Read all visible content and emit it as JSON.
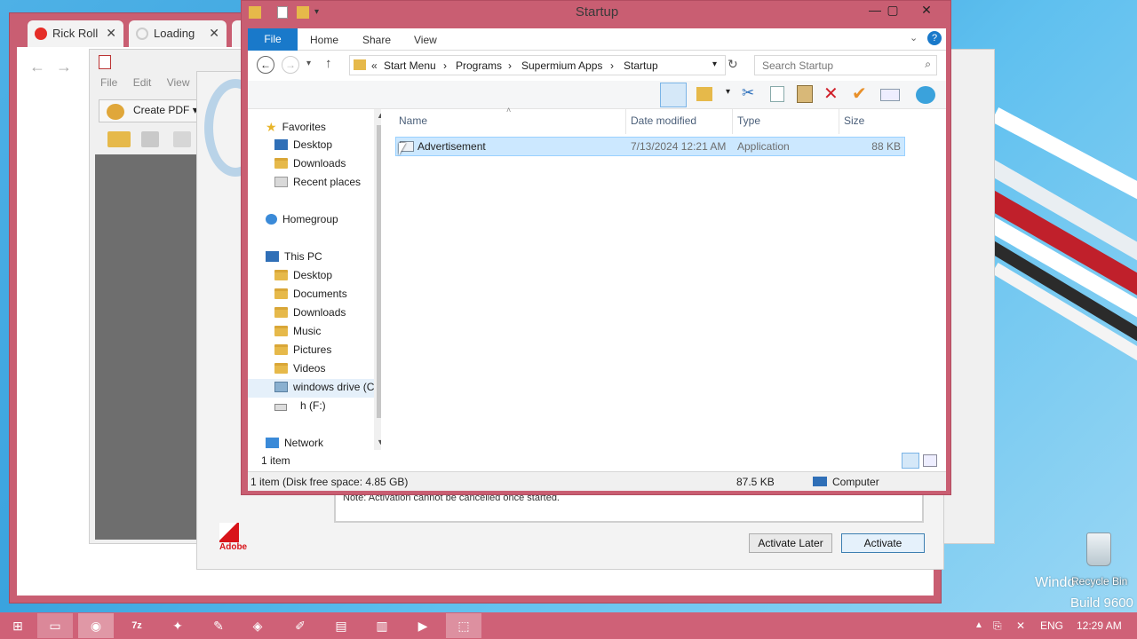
{
  "browser": {
    "tabs": [
      {
        "label": "Rick Roll",
        "icon": "youtube-icon"
      },
      {
        "label": "Loading",
        "icon": "loading-icon"
      }
    ]
  },
  "pdf_app": {
    "menu": [
      "File",
      "Edit",
      "View"
    ],
    "create_pdf_label": "Create PDF",
    "brand_label": "Adobe"
  },
  "dialog": {
    "note": "Note: Activation cannot be cancelled once started.",
    "activate_later_label": "Activate Later",
    "activate_label": "Activate"
  },
  "explorer": {
    "title": "Startup",
    "ribbon_tabs": [
      "File",
      "Home",
      "Share",
      "View"
    ],
    "breadcrumb": {
      "prefix": "«",
      "items": [
        "Start Menu",
        "Programs",
        "Supermium Apps",
        "Startup"
      ]
    },
    "search_placeholder": "Search Startup",
    "nav": {
      "favorites": {
        "label": "Favorites",
        "items": [
          "Desktop",
          "Downloads",
          "Recent places"
        ]
      },
      "homegroup": "Homegroup",
      "this_pc": {
        "label": "This PC",
        "items": [
          "Desktop",
          "Documents",
          "Downloads",
          "Music",
          "Pictures",
          "Videos",
          "windows drive (C",
          "h (F:)"
        ]
      },
      "network": "Network"
    },
    "columns": [
      "Name",
      "Date modified",
      "Type",
      "Size"
    ],
    "files": [
      {
        "name": "Advertisement",
        "date": "7/13/2024 12:21 AM",
        "type": "Application",
        "size": "88 KB"
      }
    ],
    "item_count": "1 item",
    "status": {
      "summary": "1 item (Disk free space: 4.85 GB)",
      "size": "87.5 KB",
      "location": "Computer"
    }
  },
  "desktop": {
    "recycle_bin_label": "Recycle Bin",
    "watermark_line1": "Windo",
    "watermark_line2": "Build 9600"
  },
  "taskbar": {
    "language": "ENG",
    "time": "12:29 AM"
  },
  "colors": {
    "window_frame": "#c95e72",
    "taskbar": "#cf6177",
    "file_tab": "#1979ca",
    "selection": "#cce8ff"
  }
}
